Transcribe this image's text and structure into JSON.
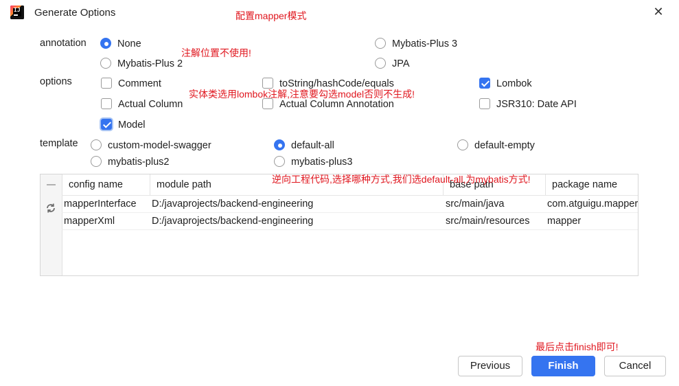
{
  "window": {
    "title": "Generate Options",
    "close": "✕"
  },
  "notes": {
    "mode": "配置mapper模式",
    "annotation": "注解位置不使用!",
    "options": "实体类选用lombok注解,注意要勾选model否则不生成!",
    "template": "逆向工程代码,选择哪种方式,我们选default-all,为mybatis方式!",
    "finish": "最后点击finish即可!"
  },
  "annotation": {
    "label": "annotation",
    "choices": [
      {
        "label": "None",
        "selected": true
      },
      {
        "label": "Mybatis-Plus 3",
        "selected": false
      },
      {
        "label": "Mybatis-Plus 2",
        "selected": false
      },
      {
        "label": "JPA",
        "selected": false
      }
    ]
  },
  "options": {
    "label": "options",
    "items": [
      {
        "label": "Comment",
        "checked": false
      },
      {
        "label": "toString/hashCode/equals",
        "checked": false
      },
      {
        "label": "Lombok",
        "checked": true
      },
      {
        "label": "Actual Column",
        "checked": false
      },
      {
        "label": "Actual Column Annotation",
        "checked": false
      },
      {
        "label": "JSR310: Date API",
        "checked": false
      },
      {
        "label": "Model",
        "checked": true
      }
    ]
  },
  "template": {
    "label": "template",
    "choices": [
      {
        "label": "custom-model-swagger",
        "selected": false
      },
      {
        "label": "default-all",
        "selected": true
      },
      {
        "label": "default-empty",
        "selected": false
      },
      {
        "label": "mybatis-plus2",
        "selected": false
      },
      {
        "label": "mybatis-plus3",
        "selected": false
      }
    ]
  },
  "table": {
    "columns": [
      "config name",
      "module path",
      "base path",
      "package name"
    ],
    "rows": [
      [
        "mapperInterface",
        "D:/javaprojects/backend-engineering",
        "src/main/java",
        "com.atguigu.mapper"
      ],
      [
        "mapperXml",
        "D:/javaprojects/backend-engineering",
        "src/main/resources",
        "mapper"
      ]
    ]
  },
  "buttons": {
    "previous": "Previous",
    "finish": "Finish",
    "cancel": "Cancel"
  },
  "colors": {
    "accent": "#3574f0",
    "note": "#e0171f"
  }
}
